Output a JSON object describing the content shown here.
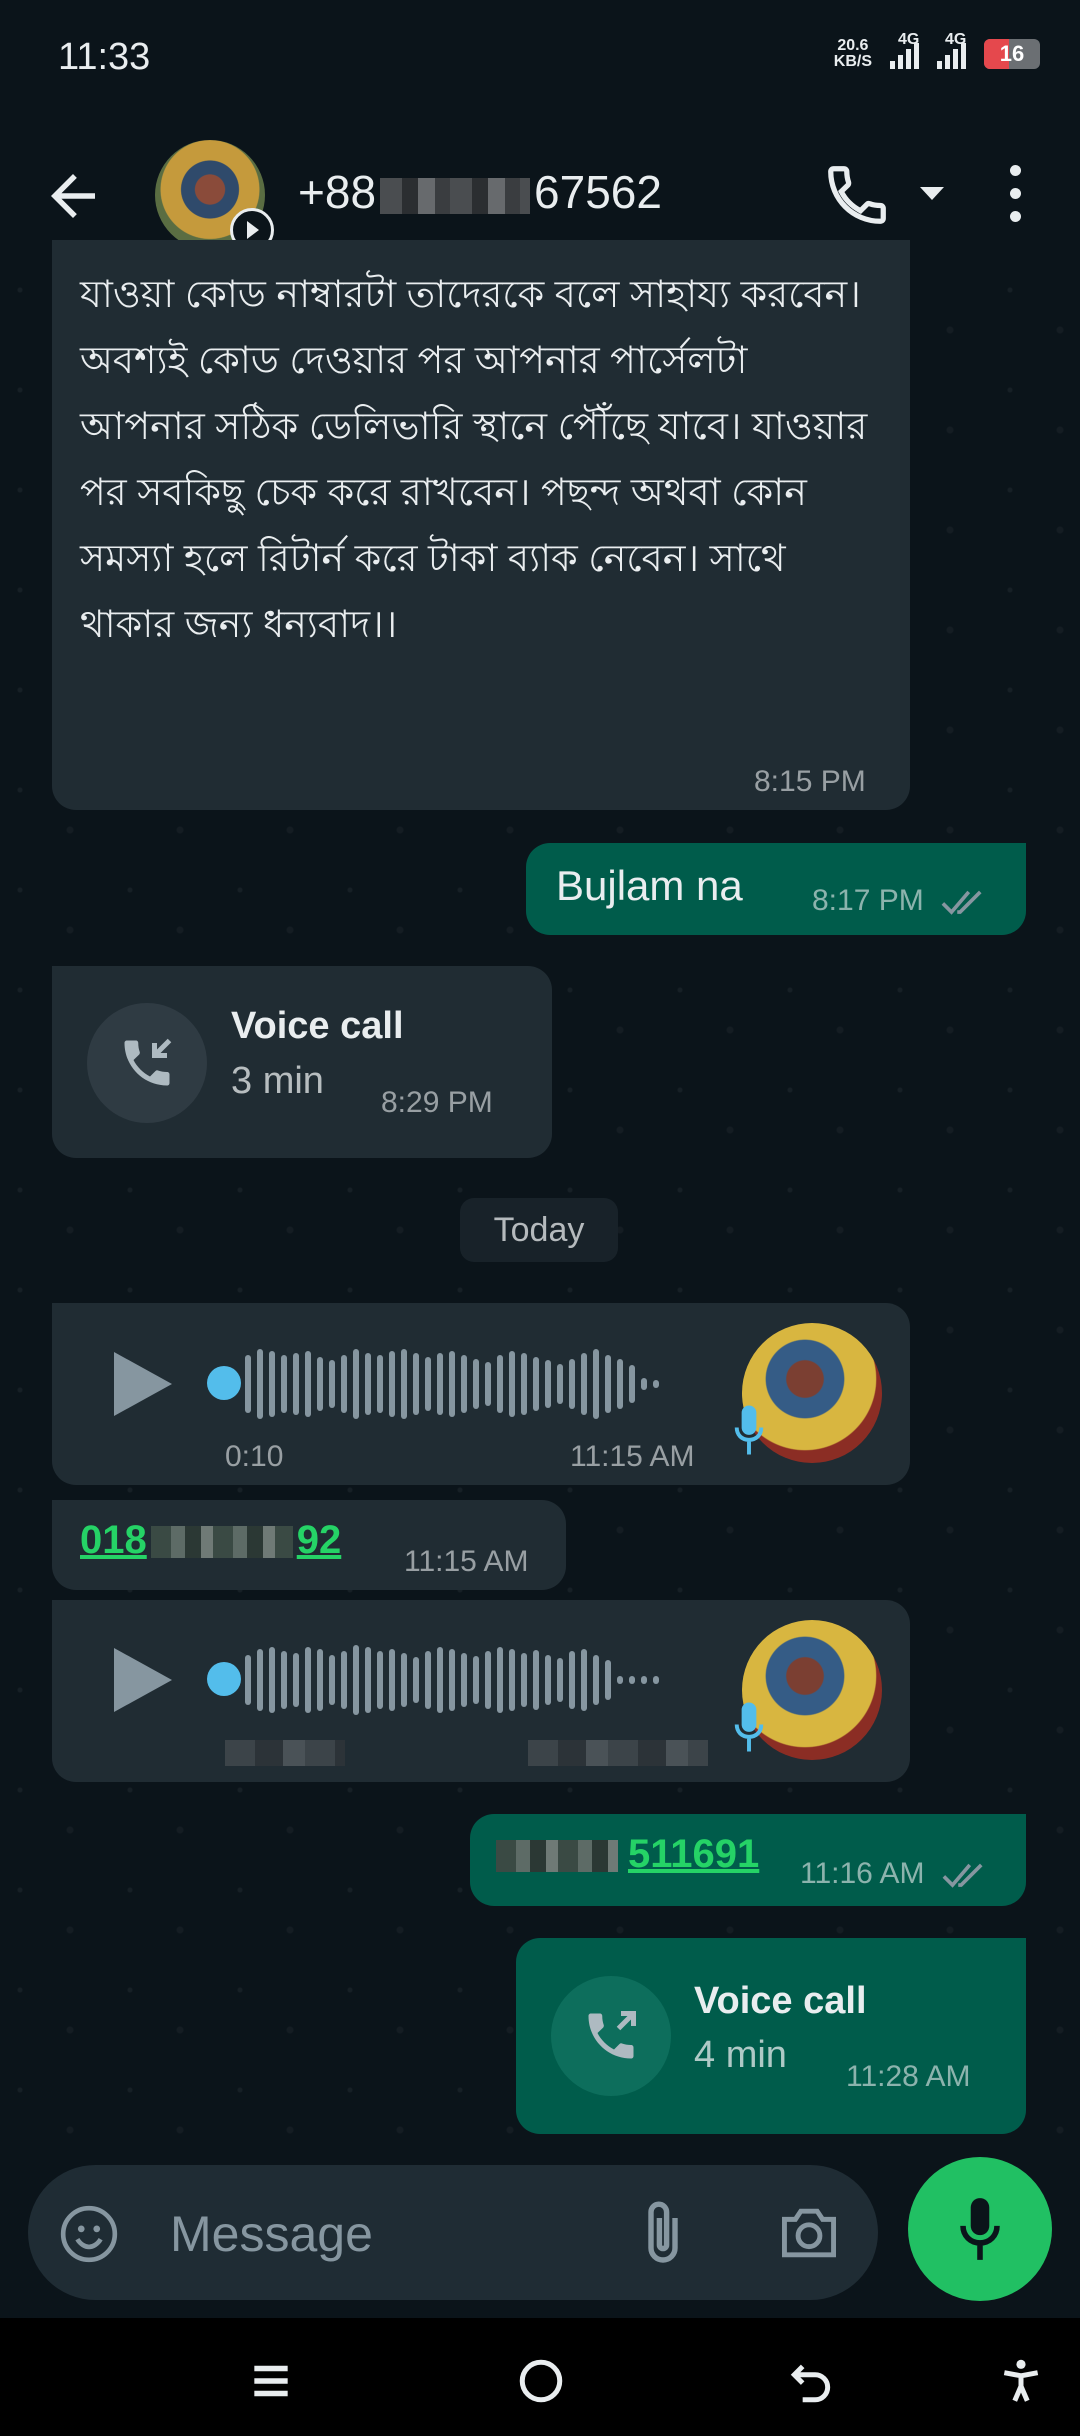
{
  "status_bar": {
    "time": "11:33",
    "net_speed_value": "20.6",
    "net_speed_unit": "KB/S",
    "signal1_label": "4G",
    "signal2_label": "4G",
    "battery_level": "16",
    "battery_color": "#e5484d"
  },
  "header": {
    "contact_prefix": "+88",
    "contact_suffix": "67562",
    "icons": [
      "back-arrow-icon",
      "call-icon",
      "dropdown-caret-icon",
      "more-vert-icon"
    ]
  },
  "messages": {
    "bangla_text": "যাওয়া কোড নাম্বারটা তাদেরকে বলে সাহায্য করবেন। অবশ্যই কোড দেওয়ার পর আপনার পার্সেলটা আপনার সঠিক ডেলিভারি স্থানে পৌঁছে যাবে। যাওয়ার পর সবকিছু চেক করে রাখবেন। পছন্দ অথবা কোন সমস্যা হলে রিটার্ন করে টাকা ব্যাক নেবেন। সাথে থাকার জন্য ধন্যবাদ।।",
    "bangla_time": "8:15 PM",
    "bujlam_text": "Bujlam na",
    "bujlam_time": "8:17 PM",
    "voice_call_1_title": "Voice call",
    "voice_call_1_duration": "3 min",
    "voice_call_1_time": "8:29 PM",
    "date_chip": "Today",
    "voice_msg_1_duration": "0:10",
    "voice_msg_1_time": "11:15 AM",
    "phone_link_1_prefix": "018",
    "phone_link_1_suffix": "92",
    "phone_link_1_time": "11:15 AM",
    "phone_link_2_suffix": "511691",
    "phone_link_2_time": "11:16 AM",
    "voice_call_2_title": "Voice call",
    "voice_call_2_duration": "4 min",
    "voice_call_2_time": "11:28 AM"
  },
  "composer": {
    "placeholder": "Message"
  },
  "colors": {
    "background": "#0b141a",
    "incoming_bubble": "#202c33",
    "outgoing_bubble": "#005c4b",
    "accent_green": "#21c063",
    "link_green": "#25d366",
    "voice_dot": "#53bdeb"
  }
}
